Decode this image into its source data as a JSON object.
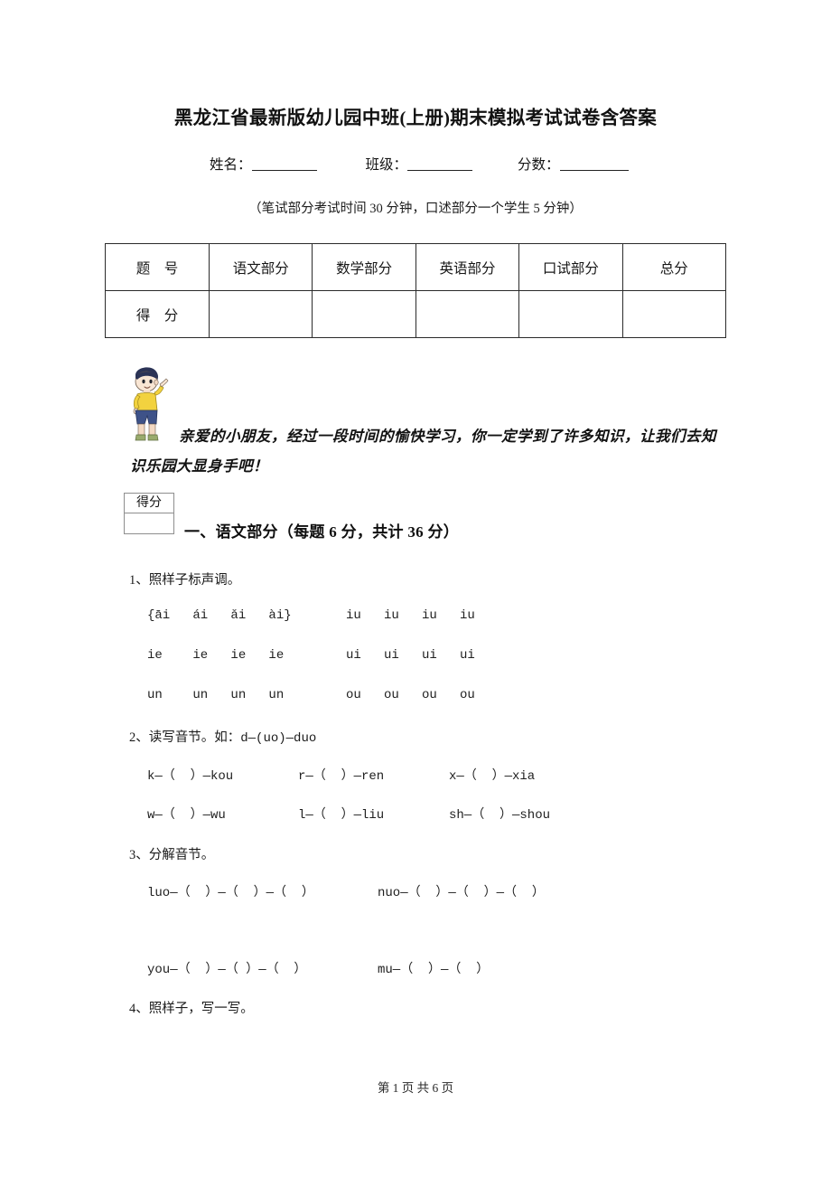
{
  "document": {
    "title": "黑龙江省最新版幼儿园中班(上册)期末模拟考试试卷含答案",
    "time_note": "（笔试部分考试时间 30 分钟，口述部分一个学生 5 分钟）"
  },
  "id_fields": {
    "name_label": "姓名：",
    "class_label": "班级：",
    "score_label": "分数："
  },
  "score_table": {
    "row_labels": [
      "题　号",
      "得　分"
    ],
    "headers": [
      "语文部分",
      "数学部分",
      "英语部分",
      "口试部分",
      "总分"
    ],
    "score_values": [
      "",
      "",
      "",
      "",
      ""
    ]
  },
  "mascot": {
    "alt": "cartoon-boy-pointing",
    "hair_color": "#2b3356",
    "shirt_color": "#f2d23f",
    "shorts_color": "#3e5288",
    "skin_color": "#f7e3d0",
    "shoe_color": "#9aab6e"
  },
  "greeting": {
    "text": "亲爱的小朋友，经过一段时间的愉快学习，你一定学到了许多知识，让我们去知识乐园大显身手吧！"
  },
  "section": {
    "score_box_label": "得分",
    "score_box_value": "",
    "heading": "一、语文部分（每题 6 分，共计 36 分）"
  },
  "questions": [
    {
      "number": "1、",
      "stem": "照样子标声调。",
      "rows": [
        {
          "left": "{āi   ái   ǎi   ài}",
          "right": "iu   iu   iu   iu"
        },
        {
          "left": "ie    ie   ie   ie",
          "right": "ui   ui   ui   ui"
        },
        {
          "left": "un    un   un   un",
          "right": "ou   ou   ou   ou"
        }
      ]
    },
    {
      "number": "2、",
      "stem": "读写音节。如：",
      "stem_example": "d—(uo)—duo",
      "rows": [
        {
          "a": "k—（  ）—kou",
          "b": "r—（  ）—ren",
          "c": "x—（  ）—xia"
        },
        {
          "a": "w—（  ）—wu",
          "b": "l—（  ）—liu",
          "c": "sh—（  ）—shou"
        }
      ]
    },
    {
      "number": "3、",
      "stem": "分解音节。",
      "rows": [
        {
          "left": "luo—（  ）—（  ）—（  ）",
          "right": "nuo—（  ）—（  ）—（  ）"
        },
        {
          "left": "you—（  ）—（ ）—（  ）",
          "right": "mu—（  ）—（  ）"
        }
      ]
    },
    {
      "number": "4、",
      "stem": "照样子，写一写。"
    }
  ],
  "footer": {
    "text": "第 1 页 共 6 页"
  }
}
